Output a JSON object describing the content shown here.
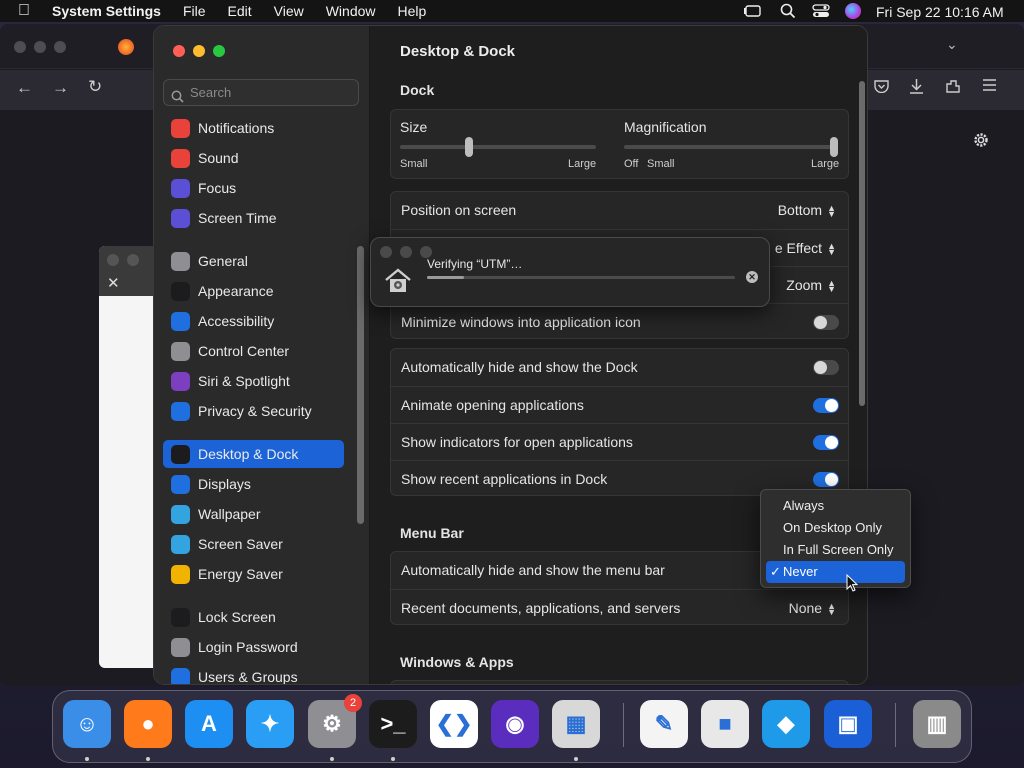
{
  "menubar": {
    "app_name": "System Settings",
    "menus": [
      "File",
      "Edit",
      "View",
      "Window",
      "Help"
    ],
    "clock": "Fri Sep 22  10:16 AM"
  },
  "window_title": "Desktop & Dock",
  "search_placeholder": "Search",
  "sidebar": {
    "items": [
      {
        "label": "Notifications",
        "icon": "bell-icon",
        "color": "#e8423b"
      },
      {
        "label": "Sound",
        "icon": "speaker-icon",
        "color": "#e8423b"
      },
      {
        "label": "Focus",
        "icon": "moon-icon",
        "color": "#5b4fd6"
      },
      {
        "label": "Screen Time",
        "icon": "hourglass-icon",
        "color": "#5b4fd6"
      },
      {
        "label": "General",
        "icon": "gear-icon",
        "color": "#8e8e93"
      },
      {
        "label": "Appearance",
        "icon": "appearance-icon",
        "color": "#1c1c1e"
      },
      {
        "label": "Accessibility",
        "icon": "accessibility-icon",
        "color": "#1f6fe0"
      },
      {
        "label": "Control Center",
        "icon": "control-center-icon",
        "color": "#8e8e93"
      },
      {
        "label": "Siri & Spotlight",
        "icon": "siri-icon",
        "color": "#7b3fc0"
      },
      {
        "label": "Privacy & Security",
        "icon": "hand-icon",
        "color": "#1f6fe0"
      },
      {
        "label": "Desktop & Dock",
        "icon": "dock-icon",
        "color": "#1c1c1e"
      },
      {
        "label": "Displays",
        "icon": "sun-icon",
        "color": "#1f6fe0"
      },
      {
        "label": "Wallpaper",
        "icon": "flower-icon",
        "color": "#34a4e0"
      },
      {
        "label": "Screen Saver",
        "icon": "screensaver-icon",
        "color": "#34a4e0"
      },
      {
        "label": "Energy Saver",
        "icon": "lightbulb-icon",
        "color": "#f0b400"
      },
      {
        "label": "Lock Screen",
        "icon": "lock-icon",
        "color": "#1c1c1e"
      },
      {
        "label": "Login Password",
        "icon": "lock-icon",
        "color": "#8e8e93"
      },
      {
        "label": "Users & Groups",
        "icon": "users-icon",
        "color": "#1f6fe0"
      }
    ],
    "selected": "Desktop & Dock"
  },
  "dock_section": {
    "heading": "Dock",
    "size_label": "Size",
    "size_min": "Small",
    "size_max": "Large",
    "size_value": 0.35,
    "magnification_label": "Magnification",
    "mag_off": "Off",
    "mag_min": "Small",
    "mag_max": "Large",
    "mag_value": 1.0,
    "position_label": "Position on screen",
    "position_value": "Bottom",
    "minimize_value_partial": "e Effect",
    "double_click_value": "Zoom",
    "minimize_icon_label": "Minimize windows into application icon",
    "minimize_icon_on": false,
    "autohide_label": "Automatically hide and show the Dock",
    "autohide_on": false,
    "animate_label": "Animate opening applications",
    "animate_on": true,
    "indicators_label": "Show indicators for open applications",
    "indicators_on": true,
    "recent_label": "Show recent applications in Dock",
    "recent_on": true
  },
  "menubar_section": {
    "heading": "Menu Bar",
    "autohide_label": "Automatically hide and show the menu bar",
    "recent_docs_label": "Recent documents, applications, and servers",
    "recent_docs_value": "None"
  },
  "windows_section": {
    "heading": "Windows & Apps"
  },
  "verify_dialog": {
    "text": "Verifying “UTM”…",
    "progress": 0.12
  },
  "popup_menu": {
    "options": [
      "Always",
      "On Desktop Only",
      "In Full Screen Only",
      "Never"
    ],
    "selected": "Never",
    "checkmark": "✓"
  },
  "dock": {
    "apps": [
      {
        "name": "Finder",
        "icon": "finder-icon",
        "color": "#3b8ee8"
      },
      {
        "name": "Firefox",
        "icon": "firefox-icon",
        "color": "#ff7a1a"
      },
      {
        "name": "App Store",
        "icon": "app-store-icon",
        "color": "#1d8ff2"
      },
      {
        "name": "Safari",
        "icon": "safari-icon",
        "color": "#2a9df4"
      },
      {
        "name": "System Settings",
        "icon": "settings-icon",
        "color": "#8e8e93",
        "badge": "2"
      },
      {
        "name": "Terminal",
        "icon": "terminal-icon",
        "color": "#1c1c1c"
      },
      {
        "name": "VS Code",
        "icon": "vscode-icon",
        "color": "#ffffff"
      },
      {
        "name": "Siri",
        "icon": "siri-icon",
        "color": "#5a2dbf"
      },
      {
        "name": "Launchpad",
        "icon": "launchpad-icon",
        "color": "#d8d8d8"
      },
      {
        "name": "TextEdit",
        "icon": "textedit-icon",
        "color": "#f4f4f4"
      },
      {
        "name": "Roblox",
        "icon": "roblox-icon",
        "color": "#e8e8e8"
      },
      {
        "name": "Roblox Studio",
        "icon": "roblox-studio-icon",
        "color": "#1e9ae8"
      },
      {
        "name": "UTM",
        "icon": "utm-icon",
        "color": "#1b5fd6"
      },
      {
        "name": "Trash",
        "icon": "trash-icon",
        "color": "#8a8a8a"
      }
    ]
  }
}
